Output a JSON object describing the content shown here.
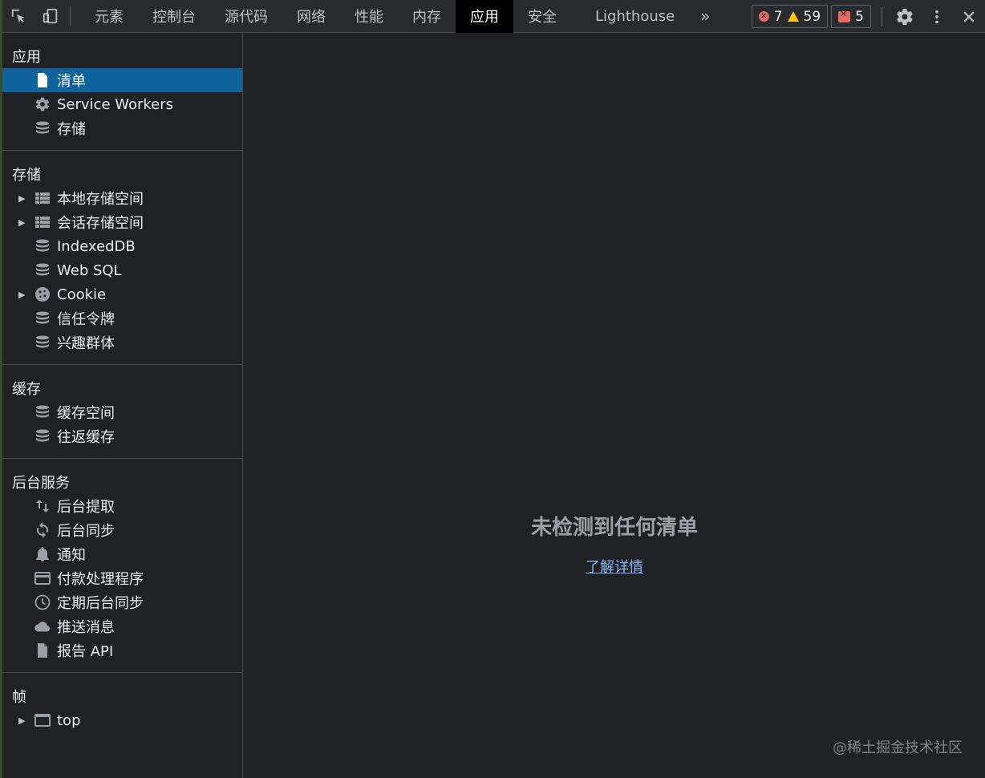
{
  "toolbar": {
    "tabs": [
      {
        "label": "元素"
      },
      {
        "label": "控制台"
      },
      {
        "label": "源代码"
      },
      {
        "label": "网络"
      },
      {
        "label": "性能"
      },
      {
        "label": "内存"
      },
      {
        "label": "应用",
        "active": true
      },
      {
        "label": "安全"
      },
      {
        "label": "Lighthouse"
      }
    ],
    "more_label": "»",
    "errors_count": "7",
    "warnings_count": "59",
    "issues_count": "5",
    "icons": [
      "inspect-element-icon",
      "device-toolbar-icon",
      "gear-icon",
      "more-vert-icon",
      "close-icon"
    ],
    "colors": {
      "error": "#e46962",
      "warning": "#f9c600",
      "active_tab_bg": "#000000",
      "selected_item_bg": "#0e639c"
    }
  },
  "sidebar": {
    "sections": [
      {
        "title": "应用",
        "items": [
          {
            "label": "清单",
            "icon": "document-icon",
            "selected": true
          },
          {
            "label": "Service Workers",
            "icon": "gear-icon"
          },
          {
            "label": "存储",
            "icon": "database-icon"
          }
        ]
      },
      {
        "title": "存储",
        "items": [
          {
            "label": "本地存储空间",
            "icon": "table-icon",
            "expandable": true
          },
          {
            "label": "会话存储空间",
            "icon": "table-icon",
            "expandable": true
          },
          {
            "label": "IndexedDB",
            "icon": "database-icon"
          },
          {
            "label": "Web SQL",
            "icon": "database-icon"
          },
          {
            "label": "Cookie",
            "icon": "cookie-icon",
            "expandable": true
          },
          {
            "label": "信任令牌",
            "icon": "database-icon"
          },
          {
            "label": "兴趣群体",
            "icon": "database-icon"
          }
        ]
      },
      {
        "title": "缓存",
        "items": [
          {
            "label": "缓存空间",
            "icon": "database-icon"
          },
          {
            "label": "往返缓存",
            "icon": "database-icon"
          }
        ]
      },
      {
        "title": "后台服务",
        "items": [
          {
            "label": "后台提取",
            "icon": "swap-vert-icon"
          },
          {
            "label": "后台同步",
            "icon": "sync-icon"
          },
          {
            "label": "通知",
            "icon": "bell-icon"
          },
          {
            "label": "付款处理程序",
            "icon": "credit-card-icon"
          },
          {
            "label": "定期后台同步",
            "icon": "clock-icon"
          },
          {
            "label": "推送消息",
            "icon": "cloud-icon"
          },
          {
            "label": "报告 API",
            "icon": "document-icon"
          }
        ]
      },
      {
        "title": "帧",
        "items": [
          {
            "label": "top",
            "icon": "frame-icon",
            "expandable": true
          }
        ]
      }
    ]
  },
  "main": {
    "empty_title": "未检测到任何清单",
    "learn_more": "了解详情",
    "watermark": "@稀土掘金技术社区"
  }
}
